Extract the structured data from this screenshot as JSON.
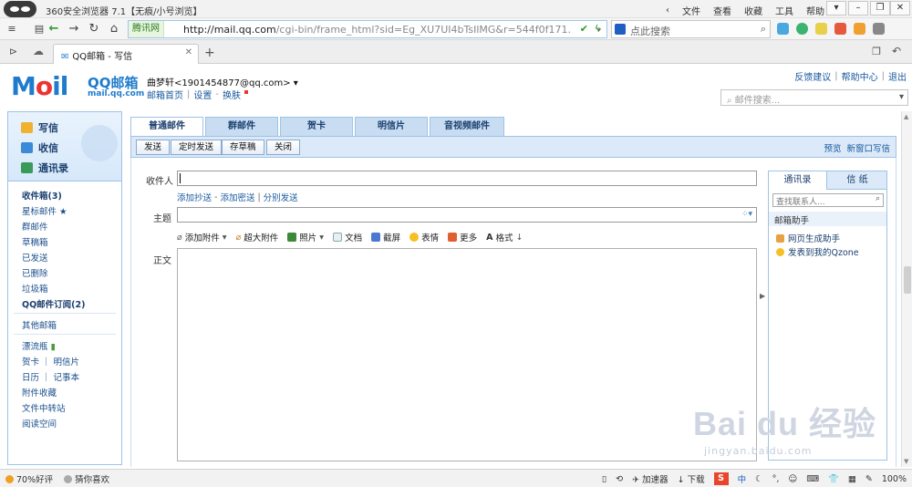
{
  "browser": {
    "title": "360安全浏览器 7.1【无痕/小号浏览】",
    "menu": [
      "文件",
      "查看",
      "收藏",
      "工具",
      "帮助"
    ],
    "site_badge": "腾讯网",
    "url_host": "http://mail.qq.com",
    "url_path": "/cgi-bin/frame_html?sid=Eg_XU7UI4bTsIlMG&r=544f0f171.",
    "search_placeholder": "点此搜索",
    "tab_title": "QQ邮箱 - 写信",
    "tab_add": "+"
  },
  "mail_header": {
    "logo_word": "Mail",
    "logo_cn": "QQ邮箱",
    "logo_domain": "mail.qq.com",
    "user": "曲梦轩<1901454877@qq.com>",
    "links": [
      "邮箱首页",
      "设置",
      "换肤"
    ],
    "top_links": [
      "反馈建议",
      "帮助中心",
      "退出"
    ],
    "search_placeholder": "邮件搜索..."
  },
  "sidebar": {
    "actions": [
      "写信",
      "收信",
      "通讯录"
    ],
    "folders": [
      {
        "label": "收件箱(3)",
        "bold": true
      },
      {
        "label": "星标邮件 ★",
        "bold": false
      },
      {
        "label": "群邮件",
        "bold": false
      },
      {
        "label": "草稿箱",
        "bold": false
      },
      {
        "label": "已发送",
        "bold": false
      },
      {
        "label": "已删除",
        "bold": false
      },
      {
        "label": "垃圾箱",
        "bold": false
      },
      {
        "label": "QQ邮件订阅(2)",
        "bold": true
      }
    ],
    "other_mail": "其他邮箱",
    "extras": [
      "漂流瓶",
      "贺卡 ｜ 明信片",
      "日历 ｜ 记事本",
      "附件收藏",
      "文件中转站",
      "阅读空间"
    ]
  },
  "compose": {
    "type_tabs": [
      "普通邮件",
      "群邮件",
      "贺卡",
      "明信片",
      "音视频邮件"
    ],
    "buttons": [
      "发送",
      "定时发送",
      "存草稿",
      "关闭"
    ],
    "right_actions": [
      "预览",
      "新窗口写信"
    ],
    "labels": {
      "to": "收件人",
      "subject": "主题",
      "body": "正文"
    },
    "addr_links": [
      "添加抄送",
      "添加密送",
      "分别发送"
    ],
    "tools": [
      "添加附件",
      "超大附件",
      "照片",
      "文档",
      "截屏",
      "表情",
      "更多",
      "格式"
    ]
  },
  "right_panel": {
    "tabs": [
      "通讯录",
      "信 纸"
    ],
    "search_placeholder": "查找联系人...",
    "helper_title": "邮箱助手",
    "helpers": [
      "网页生成助手",
      "发表到我的Qzone"
    ]
  },
  "statusbar": {
    "rating": "70%好评",
    "guess": "猜你喜欢",
    "right": [
      "加速器",
      "下载",
      "中",
      "100%"
    ]
  },
  "watermark": {
    "main": "Bai du 经验",
    "sub": "jingyan.baidu.com"
  },
  "colors": {
    "accent_blue": "#1f7ccc",
    "panel_blue": "#dbe9f8",
    "border_blue": "#9fc3e6",
    "red": "#e33333",
    "green": "#2e9b2e"
  }
}
